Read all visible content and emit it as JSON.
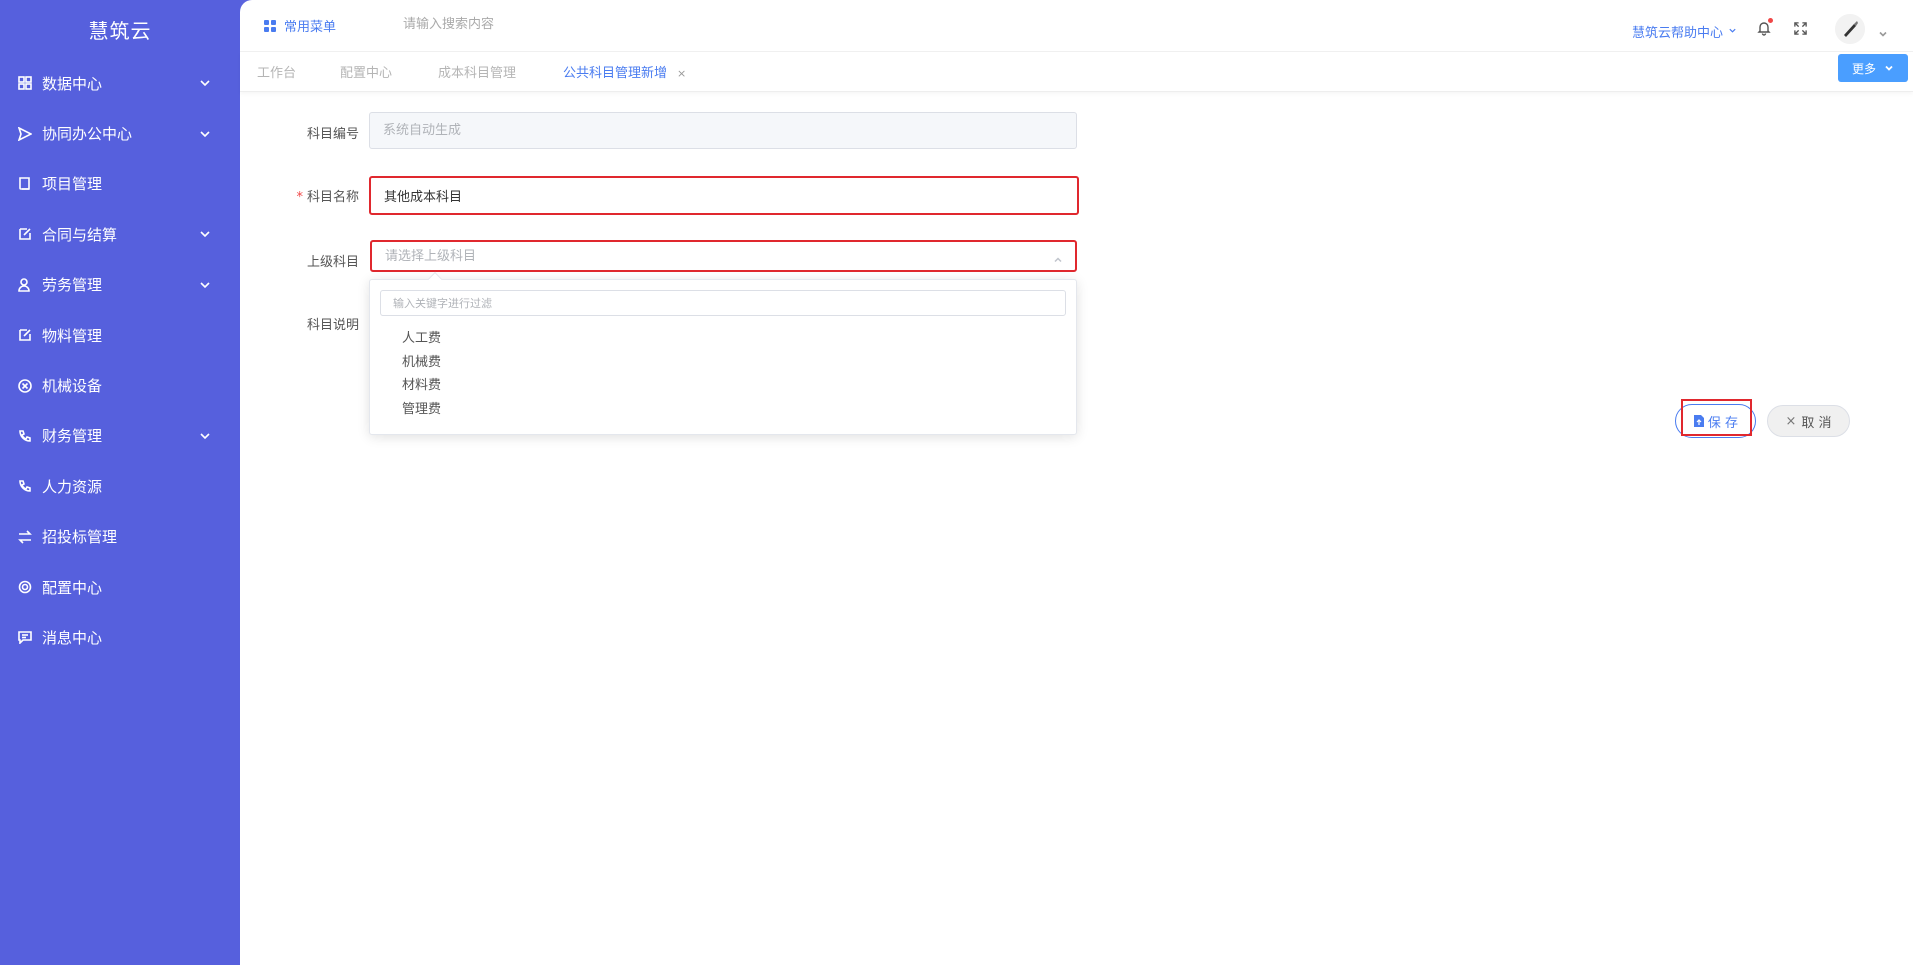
{
  "app": {
    "title": "慧筑云"
  },
  "sidebar": {
    "items": [
      {
        "label": "数据中心",
        "icon": "grid-icon",
        "expandable": true
      },
      {
        "label": "协同办公中心",
        "icon": "send-icon",
        "expandable": true
      },
      {
        "label": "项目管理",
        "icon": "book-icon",
        "expandable": false
      },
      {
        "label": "合同与结算",
        "icon": "edit-icon",
        "expandable": true
      },
      {
        "label": "劳务管理",
        "icon": "worker-icon",
        "expandable": true
      },
      {
        "label": "物料管理",
        "icon": "edit-icon",
        "expandable": false
      },
      {
        "label": "机械设备",
        "icon": "cross-circle-icon",
        "expandable": false
      },
      {
        "label": "财务管理",
        "icon": "phone-icon",
        "expandable": true
      },
      {
        "label": "人力资源",
        "icon": "phone-icon",
        "expandable": false
      },
      {
        "label": "招投标管理",
        "icon": "transfer-icon",
        "expandable": false
      },
      {
        "label": "配置中心",
        "icon": "gear-icon",
        "expandable": false
      },
      {
        "label": "消息中心",
        "icon": "message-icon",
        "expandable": false
      }
    ]
  },
  "topbar": {
    "common_menu": "常用菜单",
    "search_placeholder": "请输入搜索内容",
    "help": "慧筑云帮助中心"
  },
  "tabs": {
    "items": [
      {
        "label": "工作台",
        "active": false
      },
      {
        "label": "配置中心",
        "active": false
      },
      {
        "label": "成本科目管理",
        "active": false
      },
      {
        "label": "公共科目管理新增",
        "active": true,
        "closable": true
      }
    ],
    "close_symbol": "×",
    "more": "更多"
  },
  "form": {
    "code": {
      "label": "科目编号",
      "placeholder": "系统自动生成"
    },
    "name": {
      "label": "科目名称",
      "required_mark": "*",
      "value": "其他成本科目"
    },
    "parent": {
      "label": "上级科目",
      "placeholder": "请选择上级科目"
    },
    "desc": {
      "label": "科目说明"
    }
  },
  "dropdown": {
    "filter_placeholder": "输入关键字进行过滤",
    "options": [
      "人工费",
      "机械费",
      "材料费",
      "管理费"
    ]
  },
  "actions": {
    "save": "保 存",
    "cancel": "取 消",
    "cancel_symbol": "×"
  },
  "colors": {
    "sidebar": "#5660dd",
    "accent": "#4a7cf0",
    "highlight": "#e0282e",
    "more_button": "#4a9eff"
  }
}
